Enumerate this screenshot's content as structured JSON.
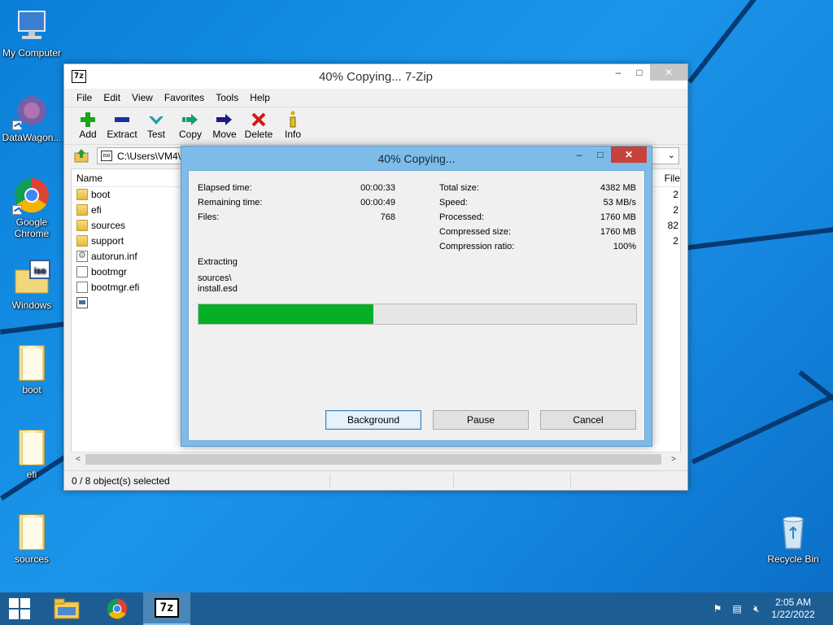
{
  "desktop": {
    "icons": [
      {
        "label": "My Computer"
      },
      {
        "label": "DataWagon..."
      },
      {
        "label": "Google Chrome"
      },
      {
        "label": "Windows"
      },
      {
        "label": "boot"
      },
      {
        "label": "efi"
      },
      {
        "label": "sources"
      },
      {
        "label": "Recycle Bin"
      }
    ]
  },
  "window": {
    "title": "40% Copying... 7-Zip",
    "menu": [
      "File",
      "Edit",
      "View",
      "Favorites",
      "Tools",
      "Help"
    ],
    "toolbar": [
      {
        "label": "Add",
        "icon": "plus-icon",
        "color": "#1aa51a"
      },
      {
        "label": "Extract",
        "icon": "minus-icon",
        "color": "#1a2fa0"
      },
      {
        "label": "Test",
        "icon": "check-icon",
        "color": "#1aa0b0"
      },
      {
        "label": "Copy",
        "icon": "copy-arrow-icon",
        "color": "#1a9a7a"
      },
      {
        "label": "Move",
        "icon": "move-arrow-icon",
        "color": "#1a1a80"
      },
      {
        "label": "Delete",
        "icon": "delete-x-icon",
        "color": "#d01a1a"
      },
      {
        "label": "Info",
        "icon": "info-icon",
        "color": "#d0b010"
      }
    ],
    "path": "C:\\Users\\VM4\\",
    "columns": {
      "name": "Name",
      "file": "File"
    },
    "files": [
      {
        "name": "boot",
        "type": "folder",
        "size": "2"
      },
      {
        "name": "efi",
        "type": "folder",
        "size": "2"
      },
      {
        "name": "sources",
        "type": "folder",
        "size": "82"
      },
      {
        "name": "support",
        "type": "folder",
        "size": "2"
      },
      {
        "name": "autorun.inf",
        "type": "gear",
        "size": ""
      },
      {
        "name": "bootmgr",
        "type": "file",
        "size": ""
      },
      {
        "name": "bootmgr.efi",
        "type": "file",
        "size": ""
      },
      {
        "name": "",
        "type": "img",
        "size": ""
      }
    ],
    "status": "0 / 8 object(s) selected"
  },
  "dialog": {
    "title": "40% Copying...",
    "elapsed_label": "Elapsed time:",
    "elapsed_value": "00:00:33",
    "remaining_label": "Remaining time:",
    "remaining_value": "00:00:49",
    "files_label": "Files:",
    "files_value": "768",
    "total_label": "Total size:",
    "total_value": "4382 MB",
    "speed_label": "Speed:",
    "speed_value": "53 MB/s",
    "processed_label": "Processed:",
    "processed_value": "1760 MB",
    "compressed_label": "Compressed size:",
    "compressed_value": "1760 MB",
    "ratio_label": "Compression ratio:",
    "ratio_value": "100%",
    "action": "Extracting",
    "current_path": "sources\\",
    "current_file": "install.esd",
    "progress_percent": 40,
    "progress_color": "#06b025",
    "buttons": {
      "background": "Background",
      "pause": "Pause",
      "cancel": "Cancel"
    }
  },
  "taskbar": {
    "time": "2:05 AM",
    "date": "1/22/2022",
    "active_app": "7z"
  }
}
